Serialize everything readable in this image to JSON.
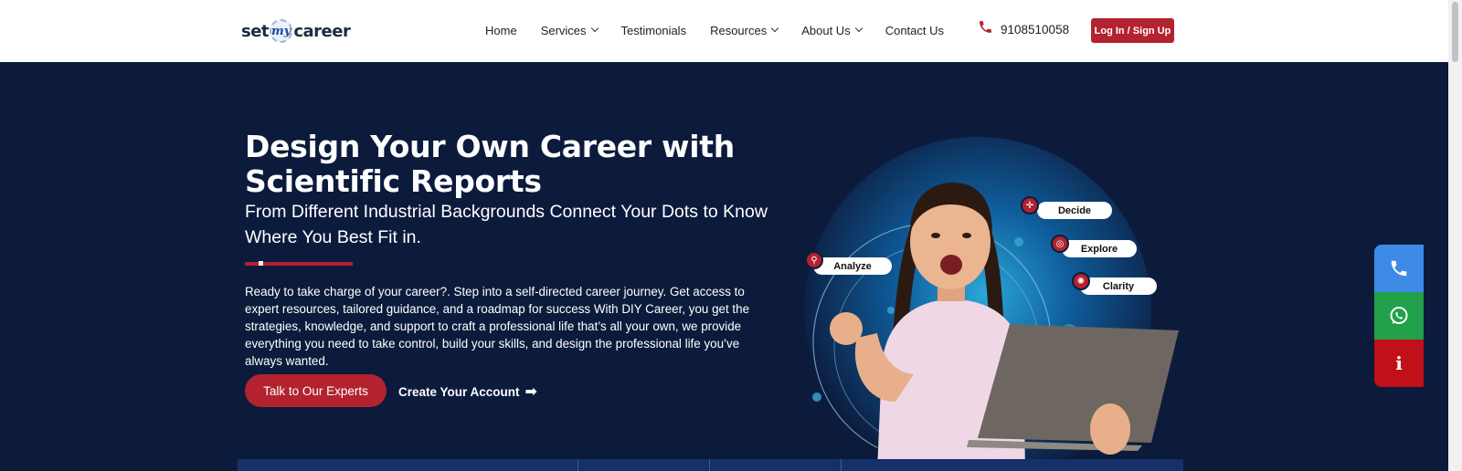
{
  "logo": {
    "part1": "set",
    "part2": "my",
    "part3": "career"
  },
  "nav": {
    "home": "Home",
    "services": "Services",
    "testimonials": "Testimonials",
    "resources": "Resources",
    "about": "About Us",
    "contact": "Contact Us"
  },
  "header": {
    "phone": "9108510058",
    "login_label": "Log In / Sign Up"
  },
  "hero": {
    "title": "Design Your Own Career with Scientific Reports",
    "subtitle": "From Different Industrial Backgrounds Connect Your Dots to Know Where You Best Fit in.",
    "description": "Ready to take charge of your career?. Step into a self-directed career journey. Get access to expert resources, tailored guidance, and a roadmap for success With DIY Career, you get the strategies, knowledge, and support to craft a professional life that’s all your own, we provide everything you need to take control, build your skills, and design the professional life you’ve always wanted.",
    "primary_cta": "Talk to Our Experts",
    "secondary_cta": "Create Your Account",
    "secondary_cta_icon": "arrow-right-icon"
  },
  "illustration": {
    "tags": {
      "decide": "Decide",
      "explore": "Explore",
      "clarity": "Clarity",
      "analyze": "Analyze"
    }
  },
  "side_buttons": {
    "info_label": "i"
  },
  "colors": {
    "accent": "#b3222f",
    "hero_bg": "#0c1b3c",
    "phone_btn": "#3d8be6",
    "whatsapp_btn": "#22a04a",
    "info_btn": "#c0101a"
  }
}
